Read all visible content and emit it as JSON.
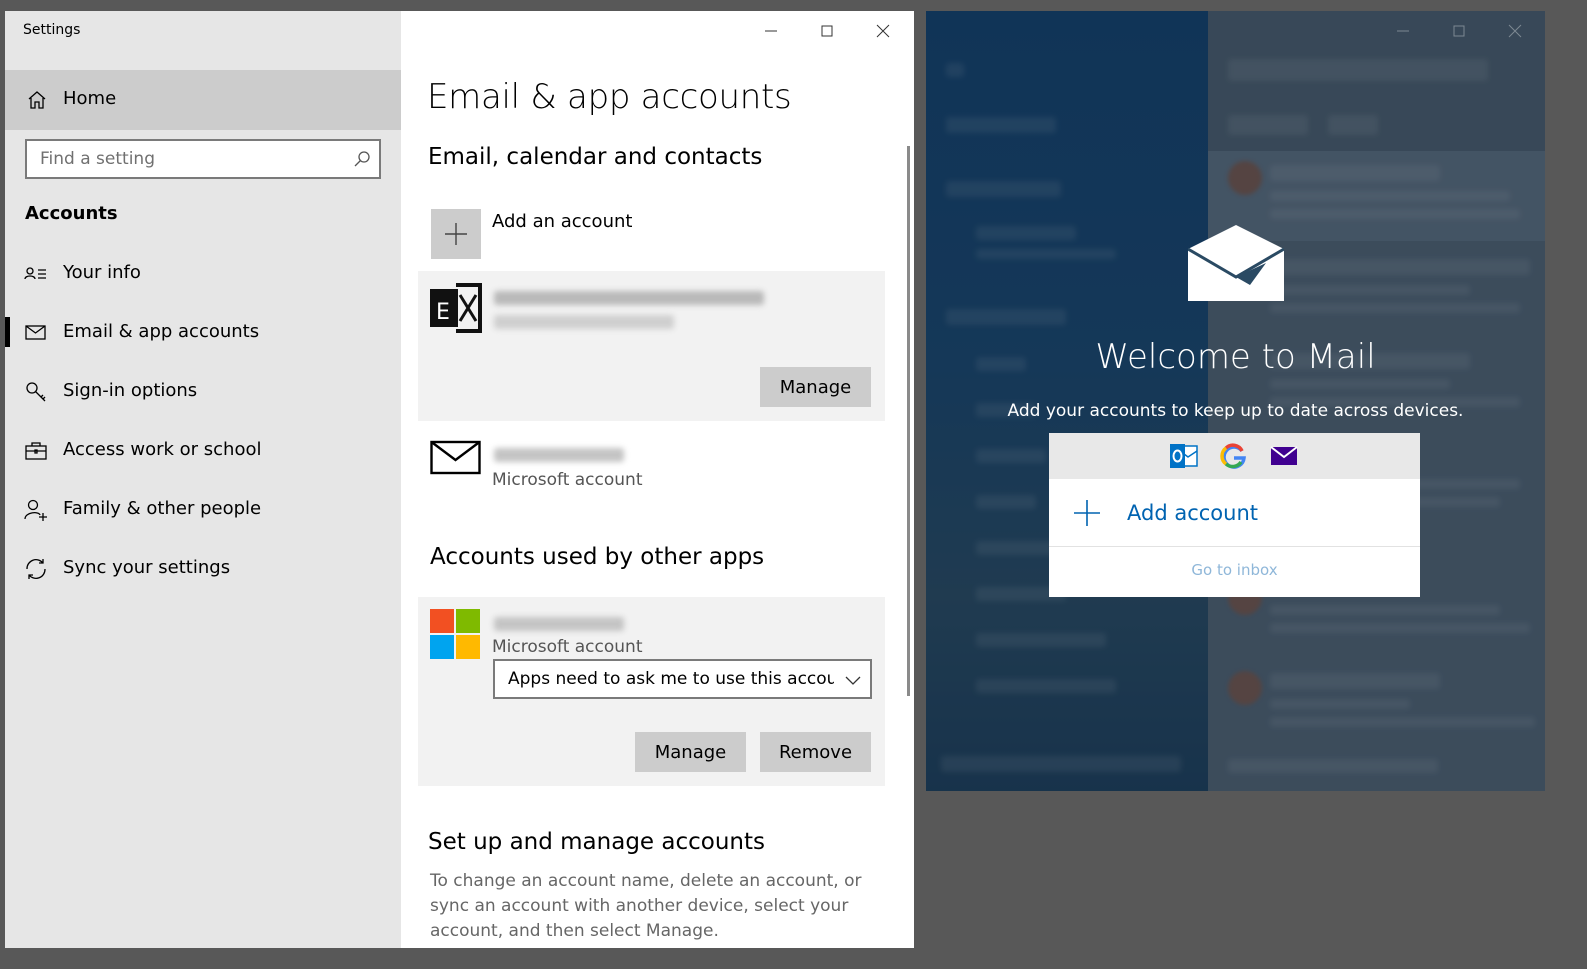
{
  "settings": {
    "window_title": "Settings",
    "sidebar": {
      "home_label": "Home",
      "search_placeholder": "Find a setting",
      "group_heading": "Accounts",
      "items": [
        {
          "label": "Your info",
          "icon": "contact-card-icon"
        },
        {
          "label": "Email & app accounts",
          "icon": "envelope-icon"
        },
        {
          "label": "Sign-in options",
          "icon": "key-icon"
        },
        {
          "label": "Access work or school",
          "icon": "briefcase-icon"
        },
        {
          "label": "Family & other people",
          "icon": "person-add-icon"
        },
        {
          "label": "Sync your settings",
          "icon": "sync-icon"
        }
      ],
      "active_index": 1
    },
    "content": {
      "title": "Email & app accounts",
      "section_email": "Email, calendar and contacts",
      "add_account_label": "Add an account",
      "email_accounts": [
        {
          "type_label": "Microsoft account",
          "icon": "envelope-icon"
        }
      ],
      "manage_label": "Manage",
      "section_other_apps": "Accounts used by other apps",
      "other_app_account": {
        "type_label": "Microsoft account",
        "permission_value": "Apps need to ask me to use this accoun",
        "manage_label": "Manage",
        "remove_label": "Remove"
      },
      "section_setup": "Set up and manage accounts",
      "setup_text": "To change an account name, delete an account, or sync an account with another device, select your account, and then select Manage."
    }
  },
  "mail": {
    "welcome_title": "Welcome to Mail",
    "welcome_subtitle": "Add your accounts to keep up to date across devices.",
    "providers": [
      "outlook-icon",
      "google-icon",
      "yahoo-mail-icon"
    ],
    "add_account_label": "Add account",
    "go_to_inbox_label": "Go to inbox"
  },
  "colors": {
    "accent": "#0063b1",
    "sidebar_bg": "#e6e6e6",
    "selected_bg": "#cccccc",
    "card_bg": "#f2f2f2"
  }
}
